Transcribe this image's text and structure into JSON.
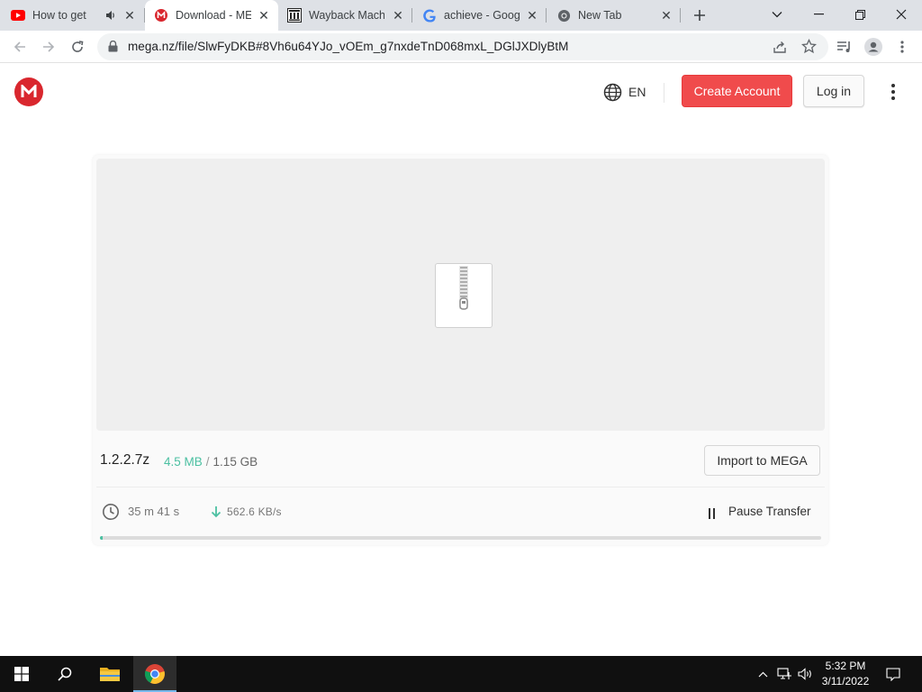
{
  "browser": {
    "tabs": [
      {
        "title": "How to get",
        "icon": "youtube-icon",
        "audio": true,
        "active": false
      },
      {
        "title": "Download - ME",
        "icon": "mega-icon",
        "audio": false,
        "active": true
      },
      {
        "title": "Wayback Machi",
        "icon": "wayback-icon",
        "audio": false,
        "active": false
      },
      {
        "title": "achieve - Goog",
        "icon": "google-icon",
        "audio": false,
        "active": false
      },
      {
        "title": "New Tab",
        "icon": "chrome-icon",
        "audio": false,
        "active": false
      }
    ],
    "url": "mega.nz/file/SlwFyDKB#8Vh6u64YJo_vOEm_g7nxdeTnD068mxL_DGlJXDlyBtM"
  },
  "header": {
    "language": "EN",
    "create_account": "Create Account",
    "login": "Log in"
  },
  "download": {
    "filename": "1.2.2.7z",
    "downloaded": "4.5 MB",
    "separator": "/",
    "total_size": "1.15 GB",
    "import_label": "Import to MEGA",
    "time_left": "35 m  41 s",
    "speed": "562.6 KB/s",
    "pause_label": "Pause Transfer",
    "progress_fraction": 0.004
  },
  "taskbar": {
    "time": "5:32 PM",
    "date": "3/11/2022"
  },
  "colors": {
    "mega_red": "#d9272e",
    "create_button": "#f04b4c",
    "progress_green": "#4cc0a2",
    "tabstrip": "#dee1e6"
  }
}
